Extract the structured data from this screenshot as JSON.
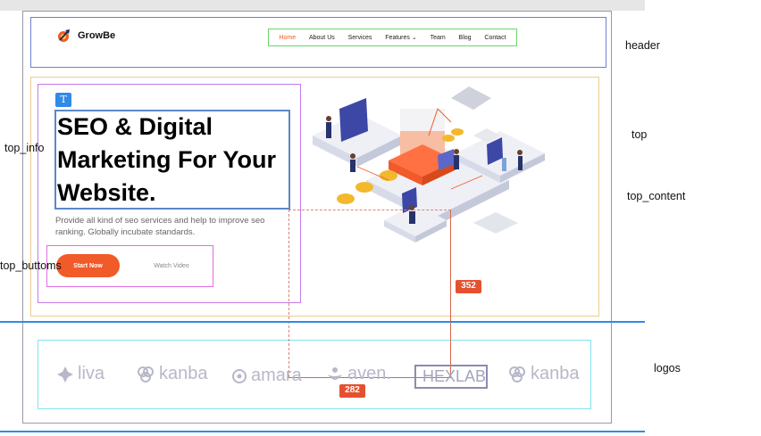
{
  "brand": {
    "name": "GrowBe"
  },
  "nav": {
    "items": [
      "Home",
      "About Us",
      "Services",
      "Features",
      "Team",
      "Blog",
      "Contact"
    ],
    "active": "Home"
  },
  "hero": {
    "badge": "T",
    "title": "SEO & Digital Marketing For Your Website.",
    "description": "Provide all kind of seo services and help to improve seo ranking. Globally incubate standards.",
    "primary_button": "Start Now",
    "secondary_button": "Watch Video"
  },
  "logos": [
    "liva",
    "kanba",
    "amara",
    "aven.",
    "HEXLAB",
    "kanba"
  ],
  "annotations": {
    "header": "header",
    "top": "top",
    "top_content": "top_content",
    "top_info": "top_info",
    "top_buttoms": "top_buttoms",
    "logos": "logos"
  },
  "measurements": {
    "distance_1": "352",
    "distance_2": "282"
  },
  "colors": {
    "accent": "#f15a29",
    "guide_blue": "#2f8ae8",
    "logo_gray": "#b7b8c8"
  }
}
